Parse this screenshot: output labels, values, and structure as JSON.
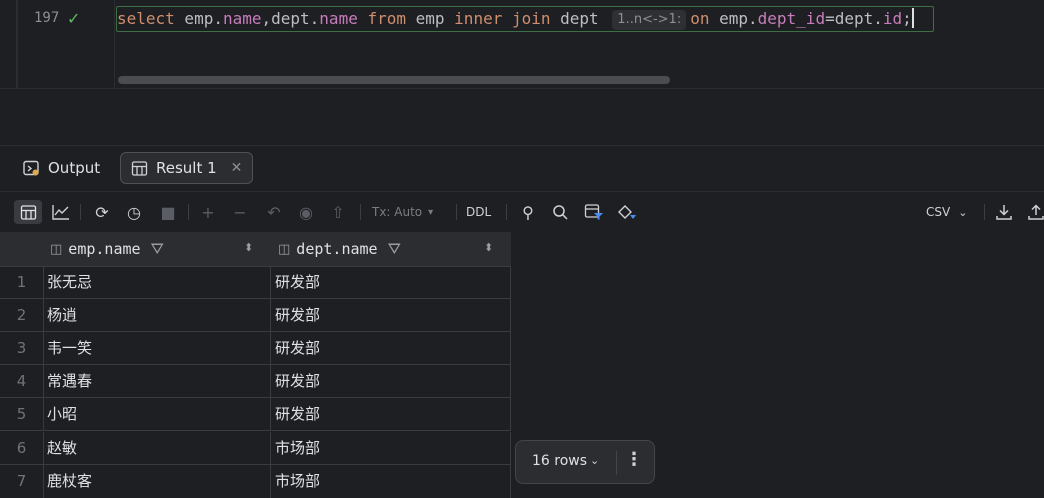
{
  "editor": {
    "line_number": "197",
    "code": {
      "t1": "select",
      "t2": " emp.",
      "t3": "name",
      "t4": ",dept.",
      "t5": "name",
      "t6": " ",
      "t7": "from",
      "t8": " emp ",
      "t9": "inner join",
      "t10": " dept ",
      "hint": "1..n<->1:",
      "t11": "on",
      "t12": " emp.",
      "t13": "dept_id",
      "t14": "=dept.",
      "t15": "id",
      "t16": ";"
    }
  },
  "tabs": {
    "output_label": "Output",
    "result_label": "Result 1"
  },
  "toolbar": {
    "tx_label": "Tx: Auto",
    "ddl_label": "DDL",
    "export_format": "CSV"
  },
  "grid": {
    "columns": [
      "emp.name",
      "dept.name"
    ],
    "rows": [
      {
        "n": "1",
        "emp_name": "张无忌",
        "dept_name": "研发部"
      },
      {
        "n": "2",
        "emp_name": "杨逍",
        "dept_name": "研发部"
      },
      {
        "n": "3",
        "emp_name": "韦一笑",
        "dept_name": "研发部"
      },
      {
        "n": "4",
        "emp_name": "常遇春",
        "dept_name": "研发部"
      },
      {
        "n": "5",
        "emp_name": "小昭",
        "dept_name": "研发部"
      },
      {
        "n": "6",
        "emp_name": "赵敏",
        "dept_name": "市场部"
      },
      {
        "n": "7",
        "emp_name": "鹿杖客",
        "dept_name": "市场部"
      }
    ]
  },
  "row_count": {
    "label": "16 rows"
  }
}
